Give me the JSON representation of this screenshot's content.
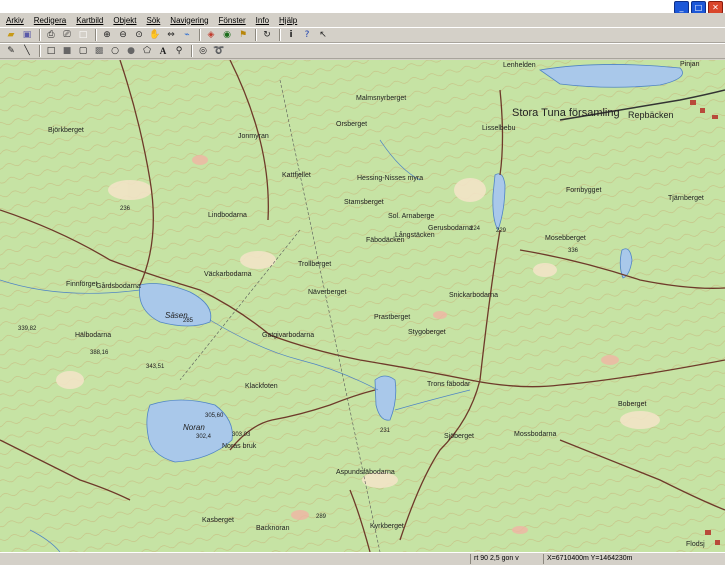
{
  "menu": [
    "Arkiv",
    "Redigera",
    "Kartbild",
    "Objekt",
    "Sök",
    "Navigering",
    "Fönster",
    "Info",
    "Hjälp"
  ],
  "window_buttons": [
    "minimize-icon",
    "maximize-icon",
    "close-icon"
  ],
  "toolbar1_icons": [
    "open-icon",
    "save-icon",
    "print-icon",
    "print-preview-icon",
    "blank-icon",
    "zoom-in-icon",
    "zoom-out-icon",
    "zoom-fit-icon",
    "pan-hand-icon",
    "measure-icon",
    "route-icon",
    "layers-icon",
    "gps-icon",
    "flag-icon",
    "refresh-icon",
    "info-icon",
    "help-icon",
    "pointer-help-icon"
  ],
  "toolbar2_icons": [
    "pencil-icon",
    "line-icon",
    "rectangle-icon",
    "filled-rectangle-icon",
    "rounded-rect-icon",
    "filled-rounded-rect-icon",
    "circle-icon",
    "filled-circle-icon",
    "polygon-icon",
    "text-icon",
    "pin-icon",
    "eye-icon",
    "lasso-icon"
  ],
  "map": {
    "lakes": [
      "Säsen",
      "Noran"
    ],
    "places": [
      "Lenhelden",
      "Stora Tuna församling",
      "Repbäcken",
      "Malmsnyrberget",
      "Björkberget",
      "Orsberget",
      "Jonmyran",
      "Gårdsbodarna",
      "Väckarbodarna",
      "Trollberget",
      "Näverberget",
      "Långstäcken",
      "Stygoberget",
      "Gatgivarbodarna",
      "Hälbodarna",
      "Trons fäbodar",
      "Boberget",
      "Sjöberget",
      "Mossbodarna",
      "Aspundsfäbodarna",
      "Kyrkberget",
      "Noras bruk",
      "Flodsj",
      "Fornbygget",
      "Lindbodarna",
      "Kattfjellet",
      "Tjärnberget",
      "Mosebberget",
      "Gerusbodarna",
      "Sol. Arnaberge",
      "Stamsberget",
      "Finnförget",
      "Kasberget",
      "Backnoran",
      "Pinjan",
      "Snickarbodarna",
      "Klackfoten",
      "Lisselbebu",
      "Prastberget",
      "Hessing-Nisses myra",
      "Fäbodäcken"
    ],
    "heights": [
      "305,60",
      "302,4",
      "303,03",
      "285",
      "231",
      "339,82",
      "388,16",
      "343,51",
      "236",
      "224",
      "229",
      "336",
      "289"
    ]
  },
  "status": {
    "scale": "rt 90 2,5 gon v",
    "coords": "X=6710400m  Y=1464230m"
  }
}
